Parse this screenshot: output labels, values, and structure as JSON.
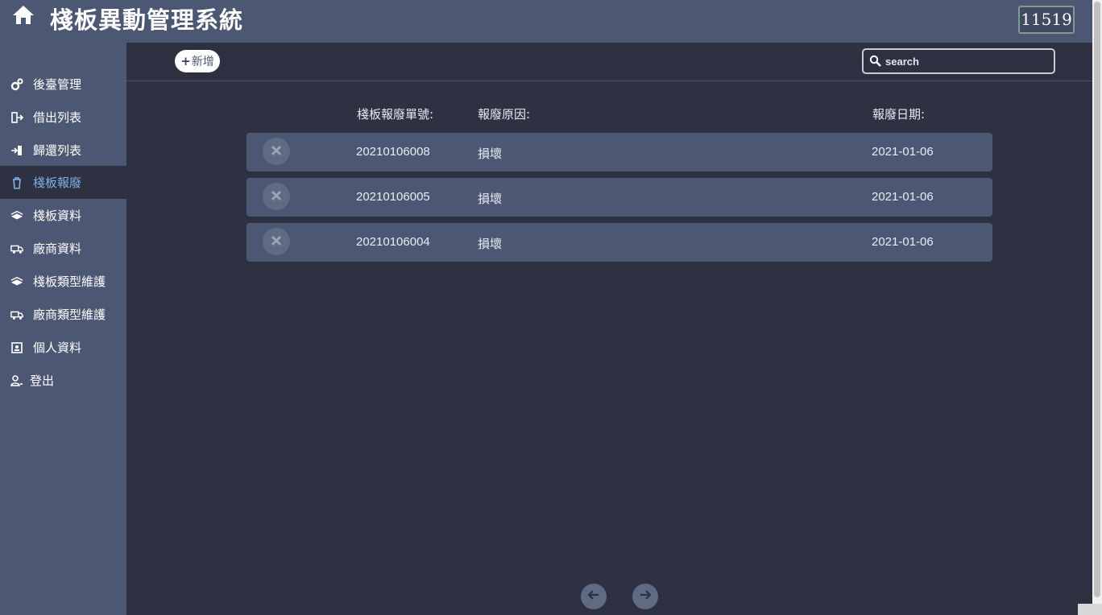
{
  "header": {
    "title": "棧板異動管理系統",
    "user_id": "11519",
    "home_icon": "home-icon"
  },
  "sidebar": {
    "items": [
      {
        "label": "後臺管理",
        "icon": "gears-icon"
      },
      {
        "label": "借出列表",
        "icon": "sign-out-icon"
      },
      {
        "label": "歸還列表",
        "icon": "sign-in-icon"
      },
      {
        "label": "棧板報廢",
        "icon": "trash-icon",
        "active": true
      },
      {
        "label": "棧板資料",
        "icon": "pallet-stack-icon"
      },
      {
        "label": "廠商資料",
        "icon": "truck-icon"
      },
      {
        "label": "棧板類型維護",
        "icon": "pallet-stack-icon"
      },
      {
        "label": "廠商類型維護",
        "icon": "truck-icon"
      },
      {
        "label": "個人資料",
        "icon": "id-card-icon"
      },
      {
        "label": "登出",
        "icon": "user-logout-icon"
      }
    ]
  },
  "toolbar": {
    "add_label": "新增",
    "search_placeholder": "search"
  },
  "table": {
    "columns": [
      "棧板報廢單號:",
      "報廢原因:",
      "報廢日期:"
    ],
    "rows": [
      {
        "id": "20210106008",
        "reason": "損壞",
        "date": "2021-01-06"
      },
      {
        "id": "20210106005",
        "reason": "損壞",
        "date": "2021-01-06"
      },
      {
        "id": "20210106004",
        "reason": "損壞",
        "date": "2021-01-06"
      }
    ]
  },
  "pager": {
    "prev_icon": "arrow-left-icon",
    "next_icon": "arrow-right-icon"
  },
  "colors": {
    "header_bg": "#4c5873",
    "content_bg": "#2e3142",
    "active_text": "#7fb0e8",
    "row_bg": "#4c5873"
  }
}
